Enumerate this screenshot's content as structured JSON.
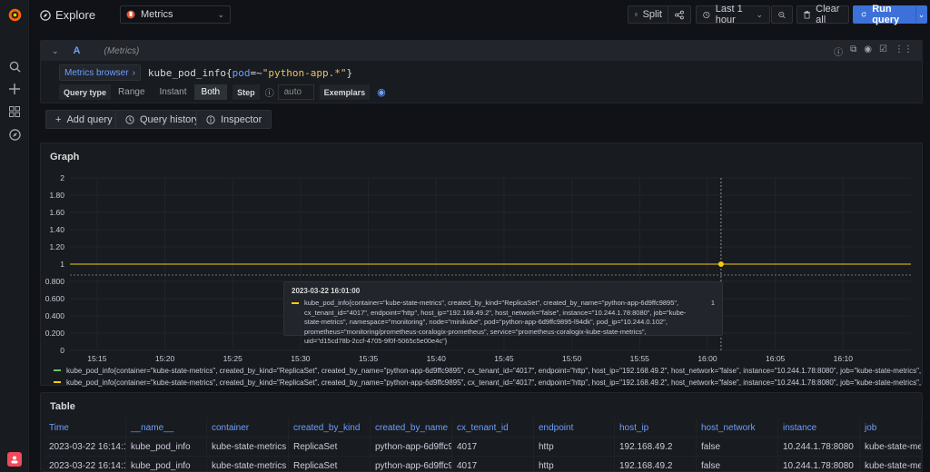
{
  "app": {
    "title": "Explore"
  },
  "datasource": {
    "name": "Metrics"
  },
  "toolbar": {
    "split_label": "Split",
    "time_range_label": "Last 1 hour",
    "clear_label": "Clear all",
    "run_label": "Run query"
  },
  "query": {
    "ref_id": "A",
    "datasource_tag": "(Metrics)",
    "metrics_browser_label": "Metrics browser",
    "expr_metric": "kube_pod_info",
    "expr_label": "pod",
    "expr_op": "=~",
    "expr_value": "\"python-app.*\"",
    "query_type_label": "Query type",
    "query_types": [
      "Range",
      "Instant",
      "Both"
    ],
    "active_query_type": "Both",
    "step_label": "Step",
    "step_placeholder": "auto",
    "exemplars_label": "Exemplars"
  },
  "actions": {
    "add_query": "Add query",
    "query_history": "Query history",
    "inspector": "Inspector"
  },
  "graph": {
    "title": "Graph",
    "legend": [
      {
        "color": "#73bf69",
        "text": "kube_pod_info{container=\"kube-state-metrics\", created_by_kind=\"ReplicaSet\", created_by_name=\"python-app-6d9ffc9895\", cx_tenant_id=\"4017\", endpoint=\"http\", host_ip=\"192.168.49.2\", host_network=\"false\", instance=\"10.244.1.78:8080\", job=\"kube-state-metrics\", namespace=\"default\", node="
      },
      {
        "color": "#f2cc0c",
        "text": "kube_pod_info{container=\"kube-state-metrics\", created_by_kind=\"ReplicaSet\", created_by_name=\"python-app-6d9ffc9895\", cx_tenant_id=\"4017\", endpoint=\"http\", host_ip=\"192.168.49.2\", host_network=\"false\", instance=\"10.244.1.78:8080\", job=\"kube-state-metrics\", namespace=\"monitoring\", node="
      }
    ],
    "tooltip": {
      "time": "2023-03-22 16:01:00",
      "text": "kube_pod_info{container=\"kube-state-metrics\", created_by_kind=\"ReplicaSet\", created_by_name=\"python-app-6d9ffc9895\", cx_tenant_id=\"4017\", endpoint=\"http\", host_ip=\"192.168.49.2\", host_network=\"false\", instance=\"10.244.1.78:8080\", job=\"kube-state-metrics\", namespace=\"monitoring\", node=\"minikube\", pod=\"python-app-6d9ffc9895-l94dk\", pod_ip=\"10.244.0.102\", prometheus=\"monitoring/prometheus-coralogix-prometheus\", service=\"prometheus-coralogix-kube-state-metrics\", uid=\"d15cd78b-2ccf-4705-9f0f-5065c5e00e4c\"}",
      "value": "1"
    }
  },
  "chart_data": {
    "type": "line",
    "title": "Graph",
    "x_ticks": [
      "15:15",
      "15:20",
      "15:25",
      "15:30",
      "15:35",
      "15:40",
      "15:45",
      "15:50",
      "15:55",
      "16:00",
      "16:05",
      "16:10"
    ],
    "y_ticks": [
      "0",
      "0.200",
      "0.400",
      "0.600",
      "0.800",
      "1",
      "1.20",
      "1.40",
      "1.60",
      "1.80",
      "2"
    ],
    "ylim": [
      0,
      2
    ],
    "x_range": [
      "15:13",
      "16:15"
    ],
    "series": [
      {
        "name": "kube_pod_info (namespace=default)",
        "color": "#73bf69",
        "x": [
          "15:13",
          "16:15"
        ],
        "values": [
          1,
          1
        ]
      },
      {
        "name": "kube_pod_info (namespace=monitoring)",
        "color": "#f2cc0c",
        "x": [
          "15:13",
          "16:15"
        ],
        "values": [
          1,
          1
        ]
      }
    ],
    "hover_time": "16:01",
    "hover_value": 1,
    "grid": true
  },
  "table": {
    "title": "Table",
    "columns": [
      "Time",
      "__name__",
      "container",
      "created_by_kind",
      "created_by_name",
      "cx_tenant_id",
      "endpoint",
      "host_ip",
      "host_network",
      "instance",
      "job"
    ],
    "rows": [
      [
        "2023-03-22 16:14:1...",
        "kube_pod_info",
        "kube-state-metrics",
        "ReplicaSet",
        "python-app-6d9ffc9...",
        "4017",
        "http",
        "192.168.49.2",
        "false",
        "10.244.1.78:8080",
        "kube-state-metric"
      ],
      [
        "2023-03-22 16:14:1...",
        "kube_pod_info",
        "kube-state-metrics",
        "ReplicaSet",
        "python-app-6d9ffc9...",
        "4017",
        "http",
        "192.168.49.2",
        "false",
        "10.244.1.78:8080",
        "kube-state-metric"
      ]
    ]
  }
}
